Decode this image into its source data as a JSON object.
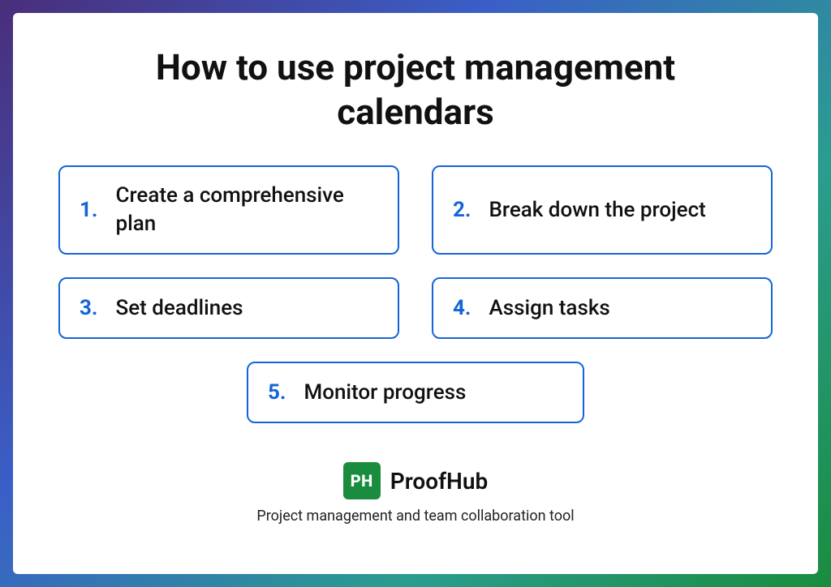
{
  "title": "How to use project management calendars",
  "steps": [
    {
      "num": "1.",
      "label": "Create a comprehensive plan"
    },
    {
      "num": "2.",
      "label": "Break down the project"
    },
    {
      "num": "3.",
      "label": "Set deadlines"
    },
    {
      "num": "4.",
      "label": "Assign tasks"
    },
    {
      "num": "5.",
      "label": "Monitor progress"
    }
  ],
  "brand": {
    "badge": "PH",
    "name": "ProofHub",
    "tagline": "Project management and team collaboration tool"
  },
  "colors": {
    "accent": "#1565d8",
    "brand_green": "#1a8c3e"
  }
}
